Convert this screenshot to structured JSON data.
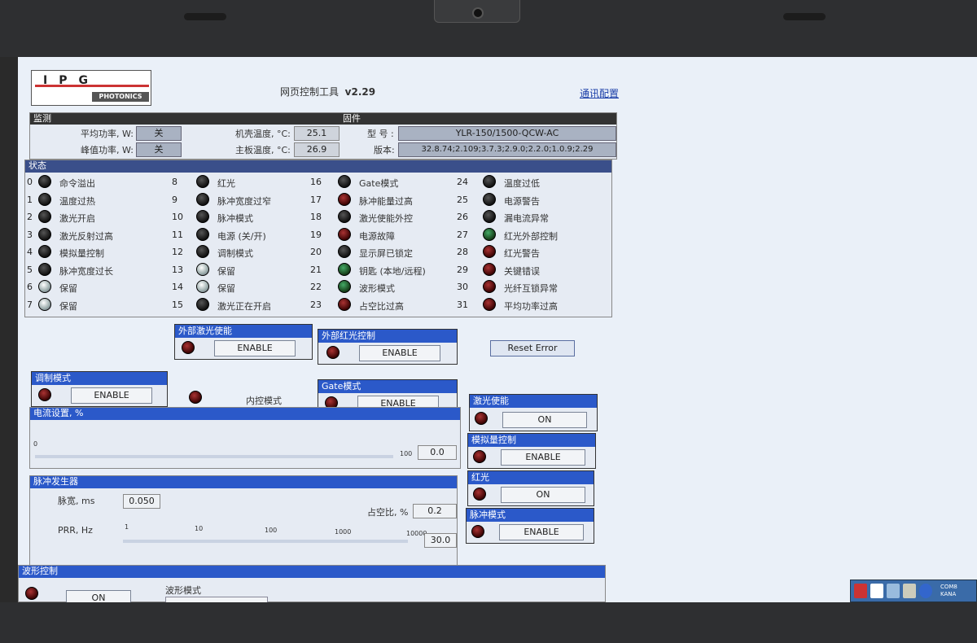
{
  "app": {
    "title": "网页控制工具",
    "version": "v2.29",
    "comm_link": "通讯配置"
  },
  "logo": {
    "text_top": "IPG",
    "text_bottom": "PHOTONICS"
  },
  "monitor": {
    "header": "监测",
    "avg_power_label": "平均功率, W:",
    "avg_power_value": "关",
    "peak_power_label": "峰值功率, W:",
    "peak_power_value": "关",
    "case_temp_label": "机壳温度, °C:",
    "case_temp_value": "25.1",
    "board_temp_label": "主板温度, °C:",
    "board_temp_value": "26.9"
  },
  "firmware": {
    "header": "固件",
    "model_label": "型 号 :",
    "model_value": "YLR-150/1500-QCW-AC",
    "version_label": "版本:",
    "version_value": "32.8.74;2.109;3.7.3;2.9.0;2.2.0;1.0.9;2.29"
  },
  "status": {
    "header": "状态",
    "items": [
      {
        "n": "0",
        "label": "命令溢出"
      },
      {
        "n": "1",
        "label": "温度过热"
      },
      {
        "n": "2",
        "label": "激光开启"
      },
      {
        "n": "3",
        "label": "激光反射过高"
      },
      {
        "n": "4",
        "label": "模拟量控制"
      },
      {
        "n": "5",
        "label": "脉冲宽度过长"
      },
      {
        "n": "6",
        "label": "保留"
      },
      {
        "n": "7",
        "label": "保留"
      },
      {
        "n": "8",
        "label": "红光"
      },
      {
        "n": "9",
        "label": "脉冲宽度过窄"
      },
      {
        "n": "10",
        "label": "脉冲模式"
      },
      {
        "n": "11",
        "label": "电源 (关/开)"
      },
      {
        "n": "12",
        "label": "调制模式"
      },
      {
        "n": "13",
        "label": "保留"
      },
      {
        "n": "14",
        "label": "保留"
      },
      {
        "n": "15",
        "label": "激光正在开启"
      },
      {
        "n": "16",
        "label": "Gate模式"
      },
      {
        "n": "17",
        "label": "脉冲能量过高"
      },
      {
        "n": "18",
        "label": "激光使能外控"
      },
      {
        "n": "19",
        "label": "电源故障"
      },
      {
        "n": "20",
        "label": "显示屏已锁定"
      },
      {
        "n": "21",
        "label": "钥匙 (本地/远程)"
      },
      {
        "n": "22",
        "label": "波形模式"
      },
      {
        "n": "23",
        "label": "占空比过高"
      },
      {
        "n": "24",
        "label": "温度过低"
      },
      {
        "n": "25",
        "label": "电源警告"
      },
      {
        "n": "26",
        "label": "漏电流异常"
      },
      {
        "n": "27",
        "label": "红光外部控制"
      },
      {
        "n": "28",
        "label": "红光警告"
      },
      {
        "n": "29",
        "label": "关键错误"
      },
      {
        "n": "30",
        "label": "光纤互锁异常"
      },
      {
        "n": "31",
        "label": "平均功率过高"
      }
    ]
  },
  "ext_laser": {
    "header": "外部激光使能",
    "button": "ENABLE"
  },
  "ext_red": {
    "header": "外部红光控制",
    "button": "ENABLE"
  },
  "reset_error": "Reset Error",
  "mod_mode": {
    "header": "调制模式",
    "button": "ENABLE",
    "internal_label": "内控模式"
  },
  "gate_mode": {
    "header": "Gate模式",
    "button": "ENABLE"
  },
  "current": {
    "header": "电流设置, %",
    "min": "0",
    "max": "100",
    "value": "0.0"
  },
  "pulse_gen": {
    "header": "脉冲发生器",
    "width_label": "脉宽, ms",
    "width_value": "0.050",
    "duty_label": "占空比, %",
    "duty_value": "0.2",
    "prr_label": "PRR, Hz",
    "prr_ticks": [
      "1",
      "10",
      "100",
      "1000",
      "10000"
    ],
    "prr_value": "30.0"
  },
  "laser_enable": {
    "header": "激光使能",
    "button": "ON"
  },
  "analog_ctrl": {
    "header": "模拟量控制",
    "button": "ENABLE"
  },
  "red_light": {
    "header": "红光",
    "button": "ON"
  },
  "pulse_mode": {
    "header": "脉冲模式",
    "button": "ENABLE"
  },
  "waveform": {
    "header": "波形控制",
    "button": "ON",
    "mode_label": "波形模式"
  },
  "tray": {
    "line1": "COM8",
    "line2": "KANA"
  }
}
